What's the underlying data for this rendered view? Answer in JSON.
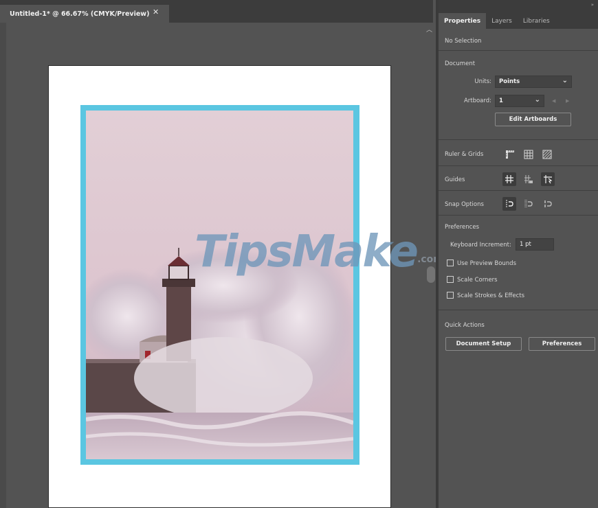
{
  "document": {
    "tab_title": "Untitled-1* @ 66.67% (CMYK/Preview)",
    "close_glyph": "✕",
    "watermark_text": "TipsMake",
    "watermark_suffix": ".com"
  },
  "panel": {
    "tabs": [
      "Properties",
      "Layers",
      "Libraries"
    ],
    "active_tab": "Properties",
    "selection_status": "No Selection",
    "document_section": {
      "title": "Document",
      "units_label": "Units:",
      "units_value": "Points",
      "artboard_label": "Artboard:",
      "artboard_value": "1",
      "edit_artboards_label": "Edit Artboards"
    },
    "ruler_grids": {
      "title": "Ruler & Grids",
      "icons": [
        "ruler-icon",
        "grid-icon",
        "transparency-grid-icon"
      ]
    },
    "guides": {
      "title": "Guides",
      "icons": [
        "guides-icon",
        "lock-guides-icon",
        "smart-guides-icon"
      ]
    },
    "snap_options": {
      "title": "Snap Options",
      "icons": [
        "snap-to-point-icon",
        "snap-to-pixel-icon",
        "snap-to-glyph-icon"
      ]
    },
    "preferences": {
      "title": "Preferences",
      "keyboard_increment_label": "Keyboard Increment:",
      "keyboard_increment_value": "1 pt",
      "checkboxes": [
        {
          "label": "Use Preview Bounds",
          "checked": false
        },
        {
          "label": "Scale Corners",
          "checked": false
        },
        {
          "label": "Scale Strokes & Effects",
          "checked": false
        }
      ]
    },
    "quick_actions": {
      "title": "Quick Actions",
      "document_setup_label": "Document Setup",
      "preferences_label": "Preferences"
    }
  },
  "colors": {
    "frame_accent": "#5bc6e1",
    "panel_bg": "#535353",
    "tab_bar_bg": "#3c3c3c"
  }
}
